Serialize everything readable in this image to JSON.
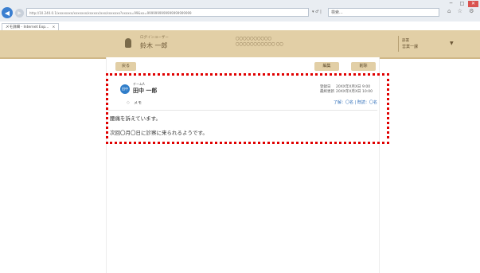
{
  "browser": {
    "url": "http://10.240.0.1/xxxxxxxx/xxxxxxx/xxxxxx/xxx/xxxxxxx?xxxxx=99&xx=9999999999999999999999",
    "url_tools": "▾ ♂ | ",
    "search_placeholder": "検索...",
    "tool_icons": "⌂ ☆ ⚙",
    "tab_title": "メモ詳細 - Internet Exp...",
    "tab_close": "×",
    "back": "◀",
    "forward": "▶",
    "win_min": "─",
    "win_max": "□",
    "win_close": "✕"
  },
  "header": {
    "user_sub": "ログインユーザー",
    "user_name": "鈴木 一郎",
    "info_line1": "〇〇〇〇〇〇〇〇〇〇",
    "info_line2": "〇〇〇〇〇〇〇〇〇〇〇 〇〇",
    "right_label": "部署",
    "right_value": "営業一課",
    "caret": "▼"
  },
  "toolbar": {
    "back_label": "戻る",
    "edit_label": "編集",
    "delete_label": "削除"
  },
  "message": {
    "avatar_text": "田中",
    "team": "チームA",
    "author": "田中 一郎",
    "memo_label": "メモ",
    "meta": [
      {
        "label": "登録日",
        "value": "20XX年X月X日 9:00"
      },
      {
        "label": "最終更新",
        "value": "20XX年X月X日 10:00"
      }
    ],
    "read_status": "了解：〇名 | 既読：〇名",
    "body": [
      "腰痛を訴えています。",
      "次回〇月〇日に診察に来られるようです。"
    ]
  },
  "colors": {
    "header_bg": "#e2cfa6",
    "button_bg": "#e2cfa6",
    "accent_blue": "#2f7dc9",
    "highlight": "#e00000"
  }
}
